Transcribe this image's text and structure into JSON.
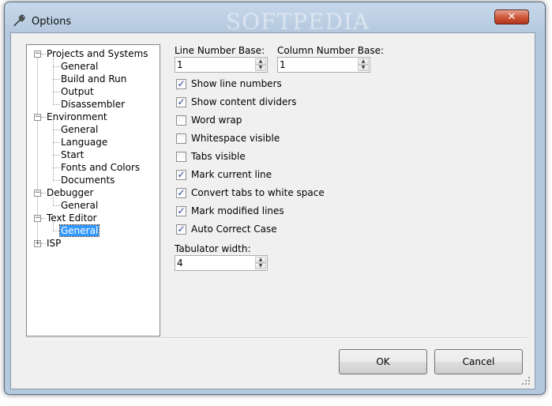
{
  "window": {
    "title": "Options",
    "watermark": "SOFTPEDIA",
    "close_symbol": "✕",
    "title_icon": "wrench-icon"
  },
  "tree": {
    "nodes": [
      {
        "label": "Projects and Systems",
        "level": 0,
        "expander": "−"
      },
      {
        "label": "General",
        "level": 1
      },
      {
        "label": "Build and Run",
        "level": 1
      },
      {
        "label": "Output",
        "level": 1
      },
      {
        "label": "Disassembler",
        "level": 1
      },
      {
        "label": "Environment",
        "level": 0,
        "expander": "−"
      },
      {
        "label": "General",
        "level": 1
      },
      {
        "label": "Language",
        "level": 1
      },
      {
        "label": "Start",
        "level": 1
      },
      {
        "label": "Fonts and Colors",
        "level": 1
      },
      {
        "label": "Documents",
        "level": 1
      },
      {
        "label": "Debugger",
        "level": 0,
        "expander": "−"
      },
      {
        "label": "General",
        "level": 1
      },
      {
        "label": "Text Editor",
        "level": 0,
        "expander": "−"
      },
      {
        "label": "General",
        "level": 1,
        "selected": true
      },
      {
        "label": "ISP",
        "level": 0,
        "expander": "+"
      }
    ]
  },
  "fields": {
    "line_number_base_label": "Line Number Base:",
    "line_number_base_value": "1",
    "column_number_base_label": "Column Number Base:",
    "column_number_base_value": "1",
    "tabulator_width_label": "Tabulator width:",
    "tabulator_width_value": "4"
  },
  "checkboxes": [
    {
      "label": "Show line numbers",
      "checked": true
    },
    {
      "label": "Show content dividers",
      "checked": true
    },
    {
      "label": "Word wrap",
      "checked": false
    },
    {
      "label": "Whitespace visible",
      "checked": false
    },
    {
      "label": "Tabs visible",
      "checked": false
    },
    {
      "label": "Mark current line",
      "checked": true
    },
    {
      "label": "Convert tabs to white space",
      "checked": true
    },
    {
      "label": "Mark modified lines",
      "checked": true
    },
    {
      "label": "Auto Correct Case",
      "checked": true
    }
  ],
  "buttons": {
    "ok_label": "OK",
    "cancel_label": "Cancel"
  },
  "colors": {
    "selection": "#3399ff",
    "checkmark": "#2a4a9a",
    "close_button": "#cf5a3d"
  }
}
